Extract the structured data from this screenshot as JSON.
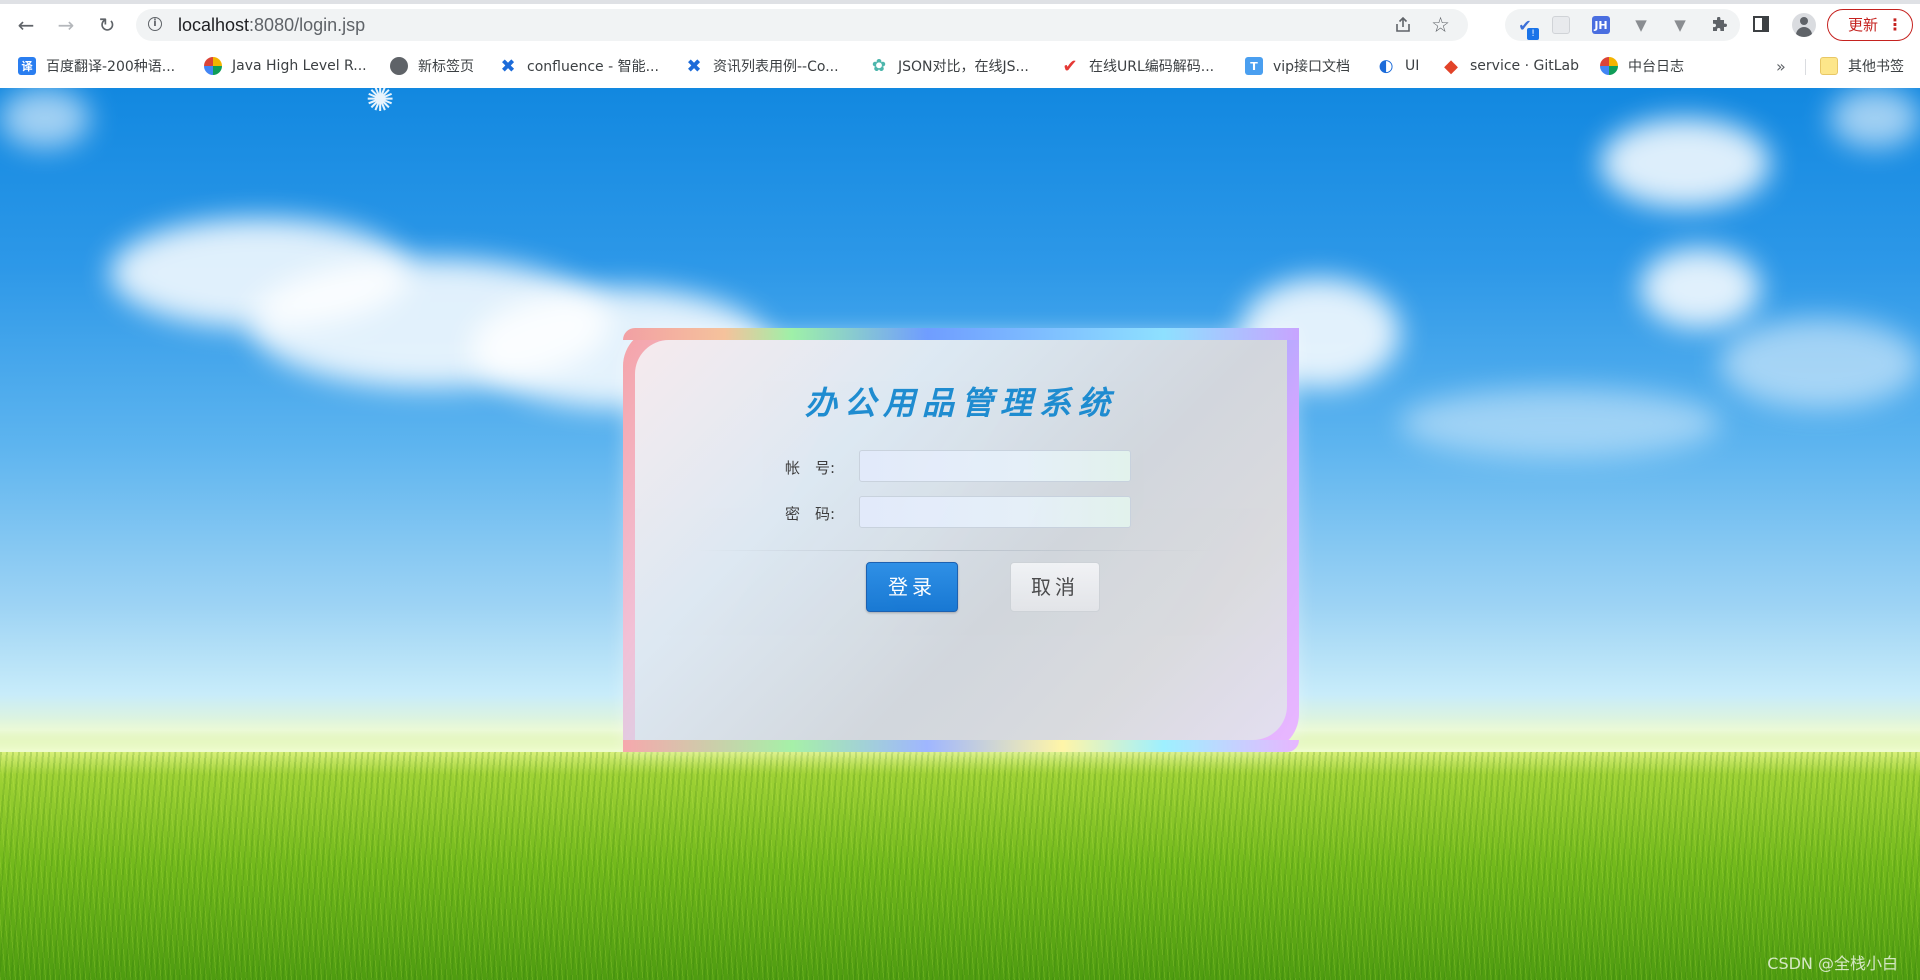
{
  "browser": {
    "url_host": "localhost",
    "url_port_path": ":8080/login.jsp",
    "update_label": "更新",
    "extensions": [
      {
        "icon": "check-shield-icon",
        "badge": "!"
      },
      {
        "icon": "blank-extension-icon"
      },
      {
        "icon": "jh-extension-icon",
        "text": "JH"
      },
      {
        "icon": "vue-devtools-icon"
      },
      {
        "icon": "vue-devtools-icon"
      },
      {
        "icon": "puzzle-icon"
      }
    ]
  },
  "bookmarks": [
    {
      "label": "百度翻译-200种语...",
      "icon": "baidu-translate-icon",
      "glyph": "译"
    },
    {
      "label": "Java High Level R...",
      "icon": "multicolor-flower-icon"
    },
    {
      "label": "新标签页",
      "icon": "gray-circle-icon"
    },
    {
      "label": "confluence - 智能...",
      "icon": "confluence-icon"
    },
    {
      "label": "资讯列表用例--Co...",
      "icon": "confluence-icon"
    },
    {
      "label": "JSON对比，在线JS...",
      "icon": "gear-flower-icon"
    },
    {
      "label": "在线URL编码解码...",
      "icon": "red-check-icon"
    },
    {
      "label": "vip接口文档",
      "icon": "t-doc-icon",
      "glyph": "T"
    },
    {
      "label": "UI",
      "icon": "blue-c-icon"
    },
    {
      "label": "service · GitLab",
      "icon": "gitlab-icon"
    },
    {
      "label": "中台日志",
      "icon": "multicolor-flower-icon"
    }
  ],
  "bookmarks_more": "»",
  "bookmarks_other": "其他书签",
  "login": {
    "title": "办公用品管理系统",
    "account_label": "帐　号:",
    "password_label": "密　码:",
    "account_value": "",
    "password_value": "",
    "login_button": "登录",
    "cancel_button": "取消"
  },
  "watermark": "CSDN @全栈小白",
  "colors": {
    "title": "#1c8bd0",
    "login_button": "#1677d3",
    "update_button": "#c5221f"
  }
}
